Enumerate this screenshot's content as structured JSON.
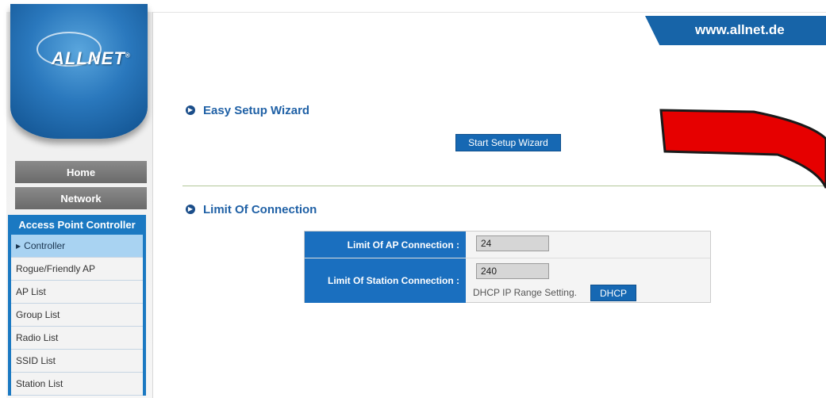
{
  "header": {
    "site_url": "www.allnet.de"
  },
  "logo": {
    "text": "ALLNET",
    "registered": "®"
  },
  "sidebar": {
    "home": "Home",
    "network": "Network",
    "section": "Access Point Controller",
    "items": [
      {
        "label": "Controller",
        "active": true
      },
      {
        "label": "Rogue/Friendly AP"
      },
      {
        "label": "AP List"
      },
      {
        "label": "Group List"
      },
      {
        "label": "Radio List"
      },
      {
        "label": "SSID List"
      },
      {
        "label": "Station List"
      }
    ]
  },
  "wizard": {
    "title": "Easy Setup Wizard",
    "button": "Start Setup Wizard"
  },
  "limits": {
    "title": "Limit Of Connection",
    "ap_label": "Limit Of AP Connection :",
    "ap_value": "24",
    "station_label": "Limit Of Station Connection :",
    "station_value": "240",
    "dhcp_note": "DHCP IP Range Setting.",
    "dhcp_button": "DHCP"
  },
  "colors": {
    "accent": "#1a6fbf",
    "arrow": "#e60000"
  },
  "icons": [
    "section-bullet-icon",
    "triangle-right-icon",
    "red-arrow-annotation"
  ]
}
